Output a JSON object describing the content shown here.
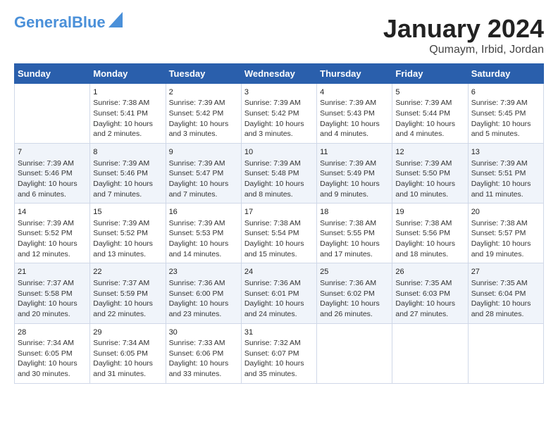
{
  "logo": {
    "line1": "General",
    "line2": "Blue"
  },
  "title": "January 2024",
  "subtitle": "Qumaym, Irbid, Jordan",
  "days_header": [
    "Sunday",
    "Monday",
    "Tuesday",
    "Wednesday",
    "Thursday",
    "Friday",
    "Saturday"
  ],
  "weeks": [
    [
      {
        "date": "",
        "sunrise": "",
        "sunset": "",
        "daylight": ""
      },
      {
        "date": "1",
        "sunrise": "Sunrise: 7:38 AM",
        "sunset": "Sunset: 5:41 PM",
        "daylight": "Daylight: 10 hours and 2 minutes."
      },
      {
        "date": "2",
        "sunrise": "Sunrise: 7:39 AM",
        "sunset": "Sunset: 5:42 PM",
        "daylight": "Daylight: 10 hours and 3 minutes."
      },
      {
        "date": "3",
        "sunrise": "Sunrise: 7:39 AM",
        "sunset": "Sunset: 5:42 PM",
        "daylight": "Daylight: 10 hours and 3 minutes."
      },
      {
        "date": "4",
        "sunrise": "Sunrise: 7:39 AM",
        "sunset": "Sunset: 5:43 PM",
        "daylight": "Daylight: 10 hours and 4 minutes."
      },
      {
        "date": "5",
        "sunrise": "Sunrise: 7:39 AM",
        "sunset": "Sunset: 5:44 PM",
        "daylight": "Daylight: 10 hours and 4 minutes."
      },
      {
        "date": "6",
        "sunrise": "Sunrise: 7:39 AM",
        "sunset": "Sunset: 5:45 PM",
        "daylight": "Daylight: 10 hours and 5 minutes."
      }
    ],
    [
      {
        "date": "7",
        "sunrise": "Sunrise: 7:39 AM",
        "sunset": "Sunset: 5:46 PM",
        "daylight": "Daylight: 10 hours and 6 minutes."
      },
      {
        "date": "8",
        "sunrise": "Sunrise: 7:39 AM",
        "sunset": "Sunset: 5:46 PM",
        "daylight": "Daylight: 10 hours and 7 minutes."
      },
      {
        "date": "9",
        "sunrise": "Sunrise: 7:39 AM",
        "sunset": "Sunset: 5:47 PM",
        "daylight": "Daylight: 10 hours and 7 minutes."
      },
      {
        "date": "10",
        "sunrise": "Sunrise: 7:39 AM",
        "sunset": "Sunset: 5:48 PM",
        "daylight": "Daylight: 10 hours and 8 minutes."
      },
      {
        "date": "11",
        "sunrise": "Sunrise: 7:39 AM",
        "sunset": "Sunset: 5:49 PM",
        "daylight": "Daylight: 10 hours and 9 minutes."
      },
      {
        "date": "12",
        "sunrise": "Sunrise: 7:39 AM",
        "sunset": "Sunset: 5:50 PM",
        "daylight": "Daylight: 10 hours and 10 minutes."
      },
      {
        "date": "13",
        "sunrise": "Sunrise: 7:39 AM",
        "sunset": "Sunset: 5:51 PM",
        "daylight": "Daylight: 10 hours and 11 minutes."
      }
    ],
    [
      {
        "date": "14",
        "sunrise": "Sunrise: 7:39 AM",
        "sunset": "Sunset: 5:52 PM",
        "daylight": "Daylight: 10 hours and 12 minutes."
      },
      {
        "date": "15",
        "sunrise": "Sunrise: 7:39 AM",
        "sunset": "Sunset: 5:52 PM",
        "daylight": "Daylight: 10 hours and 13 minutes."
      },
      {
        "date": "16",
        "sunrise": "Sunrise: 7:39 AM",
        "sunset": "Sunset: 5:53 PM",
        "daylight": "Daylight: 10 hours and 14 minutes."
      },
      {
        "date": "17",
        "sunrise": "Sunrise: 7:38 AM",
        "sunset": "Sunset: 5:54 PM",
        "daylight": "Daylight: 10 hours and 15 minutes."
      },
      {
        "date": "18",
        "sunrise": "Sunrise: 7:38 AM",
        "sunset": "Sunset: 5:55 PM",
        "daylight": "Daylight: 10 hours and 17 minutes."
      },
      {
        "date": "19",
        "sunrise": "Sunrise: 7:38 AM",
        "sunset": "Sunset: 5:56 PM",
        "daylight": "Daylight: 10 hours and 18 minutes."
      },
      {
        "date": "20",
        "sunrise": "Sunrise: 7:38 AM",
        "sunset": "Sunset: 5:57 PM",
        "daylight": "Daylight: 10 hours and 19 minutes."
      }
    ],
    [
      {
        "date": "21",
        "sunrise": "Sunrise: 7:37 AM",
        "sunset": "Sunset: 5:58 PM",
        "daylight": "Daylight: 10 hours and 20 minutes."
      },
      {
        "date": "22",
        "sunrise": "Sunrise: 7:37 AM",
        "sunset": "Sunset: 5:59 PM",
        "daylight": "Daylight: 10 hours and 22 minutes."
      },
      {
        "date": "23",
        "sunrise": "Sunrise: 7:36 AM",
        "sunset": "Sunset: 6:00 PM",
        "daylight": "Daylight: 10 hours and 23 minutes."
      },
      {
        "date": "24",
        "sunrise": "Sunrise: 7:36 AM",
        "sunset": "Sunset: 6:01 PM",
        "daylight": "Daylight: 10 hours and 24 minutes."
      },
      {
        "date": "25",
        "sunrise": "Sunrise: 7:36 AM",
        "sunset": "Sunset: 6:02 PM",
        "daylight": "Daylight: 10 hours and 26 minutes."
      },
      {
        "date": "26",
        "sunrise": "Sunrise: 7:35 AM",
        "sunset": "Sunset: 6:03 PM",
        "daylight": "Daylight: 10 hours and 27 minutes."
      },
      {
        "date": "27",
        "sunrise": "Sunrise: 7:35 AM",
        "sunset": "Sunset: 6:04 PM",
        "daylight": "Daylight: 10 hours and 28 minutes."
      }
    ],
    [
      {
        "date": "28",
        "sunrise": "Sunrise: 7:34 AM",
        "sunset": "Sunset: 6:05 PM",
        "daylight": "Daylight: 10 hours and 30 minutes."
      },
      {
        "date": "29",
        "sunrise": "Sunrise: 7:34 AM",
        "sunset": "Sunset: 6:05 PM",
        "daylight": "Daylight: 10 hours and 31 minutes."
      },
      {
        "date": "30",
        "sunrise": "Sunrise: 7:33 AM",
        "sunset": "Sunset: 6:06 PM",
        "daylight": "Daylight: 10 hours and 33 minutes."
      },
      {
        "date": "31",
        "sunrise": "Sunrise: 7:32 AM",
        "sunset": "Sunset: 6:07 PM",
        "daylight": "Daylight: 10 hours and 35 minutes."
      },
      {
        "date": "",
        "sunrise": "",
        "sunset": "",
        "daylight": ""
      },
      {
        "date": "",
        "sunrise": "",
        "sunset": "",
        "daylight": ""
      },
      {
        "date": "",
        "sunrise": "",
        "sunset": "",
        "daylight": ""
      }
    ]
  ]
}
